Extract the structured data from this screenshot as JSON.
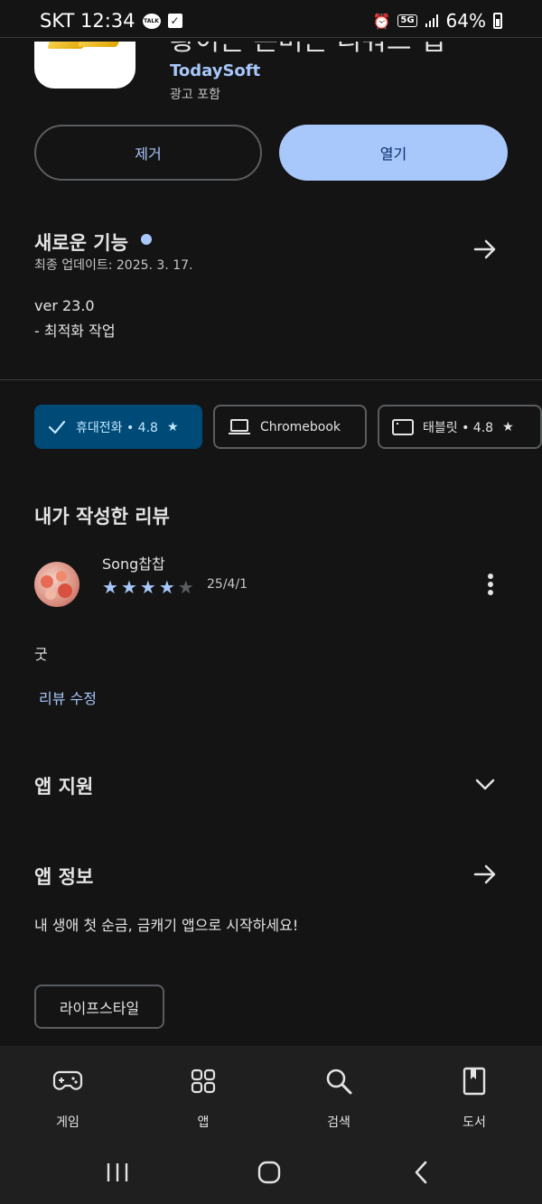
{
  "status_bar": {
    "carrier_time": "SKT 12:34",
    "talk_badge": "TALK",
    "network": "5G",
    "battery": "64%"
  },
  "app": {
    "title": "황이는 돈버는 리워드 앱",
    "developer": "TodaySoft",
    "ads_label": "광고 포함",
    "remove_label": "제거",
    "open_label": "열기"
  },
  "whats_new": {
    "title": "새로운 기능",
    "updated": "최종 업데이트: 2025. 3. 17.",
    "version": "ver 23.0",
    "notes": "- 최적화 작업"
  },
  "device_chips": [
    {
      "label": "휴대전화 • 4.8",
      "icon": "check-icon",
      "selected": true
    },
    {
      "label": "Chromebook",
      "icon": "laptop-icon",
      "selected": false
    },
    {
      "label": "태블릿 • 4.8",
      "icon": "tablet-icon",
      "selected": false
    }
  ],
  "my_review": {
    "section_title": "내가 작성한 리뷰",
    "author": "Song찹찹",
    "rating": 4,
    "date": "25/4/1",
    "text": "굿",
    "edit_label": "리뷰 수정"
  },
  "app_support": {
    "title": "앱 지원"
  },
  "app_info": {
    "title": "앱 정보",
    "description": "내 생애 첫 순금, 금캐기 앱으로 시작하세요!",
    "category": "라이프스타일"
  },
  "bottom_nav": [
    {
      "label": "게임",
      "icon": "gamepad-icon"
    },
    {
      "label": "앱",
      "icon": "apps-grid-icon"
    },
    {
      "label": "검색",
      "icon": "search-icon"
    },
    {
      "label": "도서",
      "icon": "book-icon"
    }
  ],
  "colors": {
    "background": "#141414",
    "accent": "#a8c7fa",
    "chip_selected": "#004a77"
  }
}
